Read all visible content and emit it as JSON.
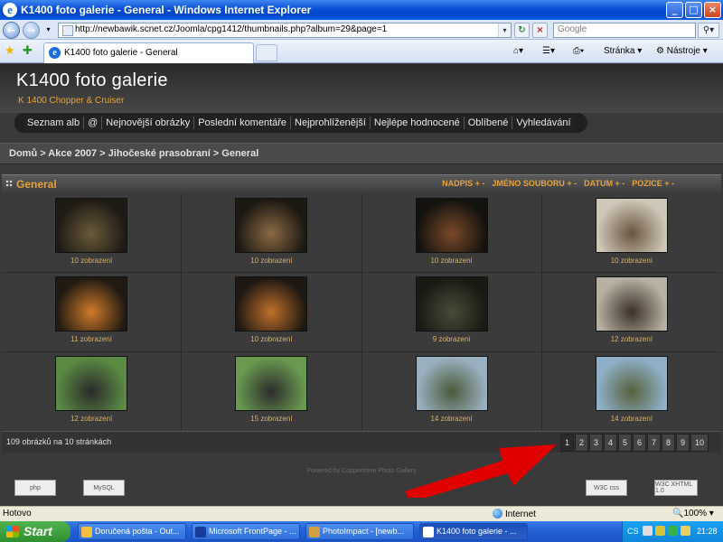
{
  "window": {
    "title": "K1400 foto galerie - General - Windows Internet Explorer"
  },
  "address": {
    "url": "http://newbawik.scnet.cz/Joomla/cpg1412/thumbnails.php?album=29&page=1"
  },
  "search": {
    "placeholder": "Google"
  },
  "tab": {
    "label": "K1400 foto galerie - General"
  },
  "commands": {
    "page": "Stránka",
    "tools": "Nástroje"
  },
  "site": {
    "title": "K1400 foto galerie",
    "subtitle": "K 1400 Chopper & Cruiser"
  },
  "menu": [
    "Seznam alb",
    "@",
    "Nejnovější obrázky",
    "Poslední komentáře",
    "Nejprohlíženější",
    "Nejlépe hodnocené",
    "Oblíbené",
    "Vyhledávání"
  ],
  "breadcrumb": "Domů > Akce 2007 > Jihočeské prasobraní > General",
  "gallery": {
    "title": "General",
    "sort": [
      "NADPIS + -",
      "JMÉNO SOUBORU + -",
      "DATUM + -",
      "POZICE + -"
    ],
    "thumbs": [
      {
        "caption": "10 zobrazení",
        "bg": "#1e1a14",
        "accent": "#6a5a3a"
      },
      {
        "caption": "10 zobrazení",
        "bg": "#1c1812",
        "accent": "#8a6a44"
      },
      {
        "caption": "10 zobrazení",
        "bg": "#14120e",
        "accent": "#7a4a2a"
      },
      {
        "caption": "10 zobrazení",
        "bg": "#cfc7b8",
        "accent": "#6a5540"
      },
      {
        "caption": "11 zobrazení",
        "bg": "#201a12",
        "accent": "#d07a2a"
      },
      {
        "caption": "10 zobrazení",
        "bg": "#1e1812",
        "accent": "#c0702a"
      },
      {
        "caption": "9 zobrazení",
        "bg": "#1a1a14",
        "accent": "#4a4a38"
      },
      {
        "caption": "12 zobrazení",
        "bg": "#b8b0a2",
        "accent": "#3a3028"
      },
      {
        "caption": "12 zobrazení",
        "bg": "#5b8a44",
        "accent": "#2a2a2a"
      },
      {
        "caption": "15 zobrazení",
        "bg": "#6a9a50",
        "accent": "#2c2c2c"
      },
      {
        "caption": "14 zobrazení",
        "bg": "#9ab0c0",
        "accent": "#4a5a3a"
      },
      {
        "caption": "14 zobrazení",
        "bg": "#8fb0c8",
        "accent": "#56603c"
      }
    ],
    "total": "109 obrázků na 10 stránkách",
    "pages": [
      "1",
      "2",
      "3",
      "4",
      "5",
      "6",
      "7",
      "8",
      "9",
      "10"
    ]
  },
  "powered": "Powered by Coppermine Photo Gallery",
  "badges": {
    "php": "php",
    "mysql": "MySQL",
    "css": "W3C css",
    "xhtml": "W3C XHTML 1.0"
  },
  "status": {
    "text": "Hotovo",
    "zone": "Internet",
    "zoom": "100%"
  },
  "taskbar": {
    "start": "Start",
    "tasks": [
      "Doručená pošta - Out...",
      "Microsoft FrontPage - ...",
      "PhotoImpact - [newb...",
      "K1400 foto galerie - ..."
    ],
    "lang": "CS",
    "time": "21:28"
  },
  "colors": {
    "accent": "#e8a23a",
    "pageBg": "#3a3a3a",
    "headerBg": "#2a2a2a"
  }
}
